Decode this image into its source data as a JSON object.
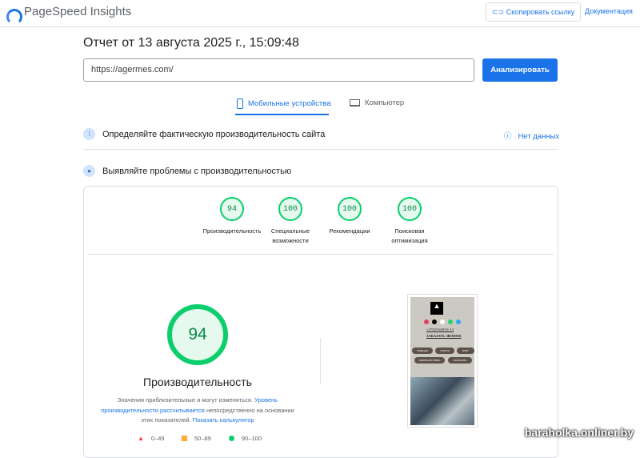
{
  "header": {
    "app_title": "PageSpeed Insights",
    "copy_link": "Скопировать ссылку",
    "docs": "Документация"
  },
  "report_title": "Отчет от 13 августа 2025 г., 15:09:48",
  "url_input": {
    "value": "https://agermes.com/"
  },
  "analyze_button": "Анализировать",
  "tabs": [
    {
      "label": "Мобильные устройства",
      "active": true
    },
    {
      "label": "Компьютер",
      "active": false
    }
  ],
  "field_section": {
    "title": "Определяйте фактическую производительность сайта",
    "status": "Нет данных"
  },
  "lab_section": {
    "title": "Выявляйте проблемы с производительностью"
  },
  "gauges": [
    {
      "score": "94",
      "label": "Производительность"
    },
    {
      "score": "100",
      "label": "Специальные возможности"
    },
    {
      "score": "100",
      "label": "Рекомендации"
    },
    {
      "score": "100",
      "label": "Поисковая оптимизация"
    }
  ],
  "main_gauge": {
    "score": "94",
    "label": "Производительность"
  },
  "description": {
    "text1": "Значения приблизительные и могут изменяться.",
    "link1": "Уровень производительности рассчитывается",
    "text2": "непосредственно на основании этих показателей.",
    "link2": "Показать калькулятор"
  },
  "legend": [
    {
      "range": "0–49",
      "color": "#ff3333"
    },
    {
      "range": "50–89",
      "color": "#ffaa33"
    },
    {
      "range": "90–100",
      "color": "#0cce6b"
    }
  ],
  "screenshot": {
    "phone": "+37529-649-91-13",
    "call": "ЗАКАЗАТЬ ЗВОНОК",
    "nav": [
      "ГЛАВНАЯ",
      "УСЛУГИ",
      "БЛОГ",
      "ОБРАТНАЯ СВЯЗЬ",
      "КОНТАКТЫ"
    ]
  },
  "watermark": "baraholka.onliner.by"
}
